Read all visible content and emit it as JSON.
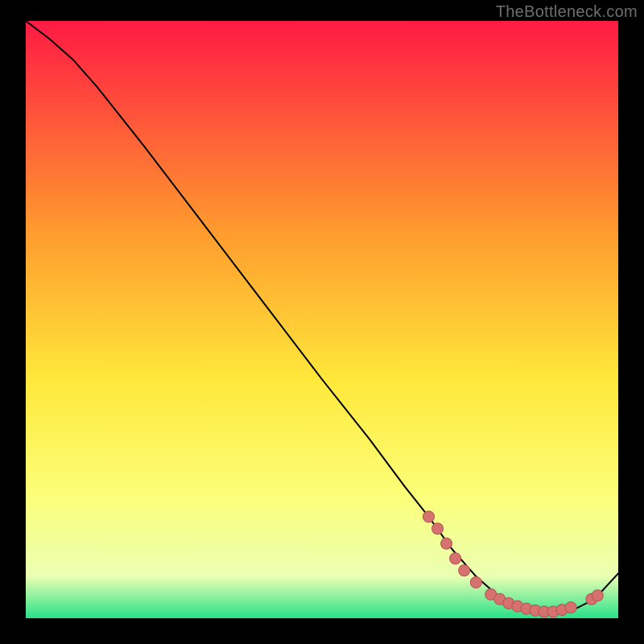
{
  "watermark": "TheBottleneck.com",
  "colors": {
    "black": "#000000",
    "curve": "#000000",
    "marker_fill": "#d5716f",
    "marker_stroke": "#b35552",
    "grad_top": "#ff1a44",
    "grad_mid1": "#ff9a2e",
    "grad_mid2": "#ffe83a",
    "grad_mid3": "#fbff7a",
    "grad_mid4": "#eaffb2",
    "grad_bot": "#28e18a"
  },
  "chart_data": {
    "type": "line",
    "title": "",
    "xlabel": "",
    "ylabel": "",
    "xlim": [
      0,
      100
    ],
    "ylim": [
      0,
      100
    ],
    "x": [
      0,
      4,
      8,
      12,
      20,
      30,
      40,
      50,
      58,
      64,
      68,
      72,
      76,
      80,
      84,
      88,
      92,
      96,
      100
    ],
    "series": [
      {
        "name": "curve",
        "values": [
          100,
          97,
          93.5,
          89,
          79,
          66,
          53,
          40,
          30,
          22,
          17,
          11.5,
          7,
          3.5,
          1.6,
          0.8,
          1.2,
          3.2,
          7.5
        ]
      }
    ],
    "markers": [
      {
        "x": 68.0,
        "y": 17.0
      },
      {
        "x": 69.5,
        "y": 15.0
      },
      {
        "x": 71.0,
        "y": 12.5
      },
      {
        "x": 72.5,
        "y": 10.0
      },
      {
        "x": 74.0,
        "y": 8.0
      },
      {
        "x": 76.0,
        "y": 6.0
      },
      {
        "x": 78.5,
        "y": 4.0
      },
      {
        "x": 80.0,
        "y": 3.2
      },
      {
        "x": 81.5,
        "y": 2.5
      },
      {
        "x": 83.0,
        "y": 2.0
      },
      {
        "x": 84.5,
        "y": 1.6
      },
      {
        "x": 86.0,
        "y": 1.3
      },
      {
        "x": 87.5,
        "y": 1.1
      },
      {
        "x": 89.0,
        "y": 1.1
      },
      {
        "x": 90.5,
        "y": 1.4
      },
      {
        "x": 92.0,
        "y": 1.8
      },
      {
        "x": 95.5,
        "y": 3.2
      },
      {
        "x": 96.5,
        "y": 3.8
      }
    ]
  }
}
